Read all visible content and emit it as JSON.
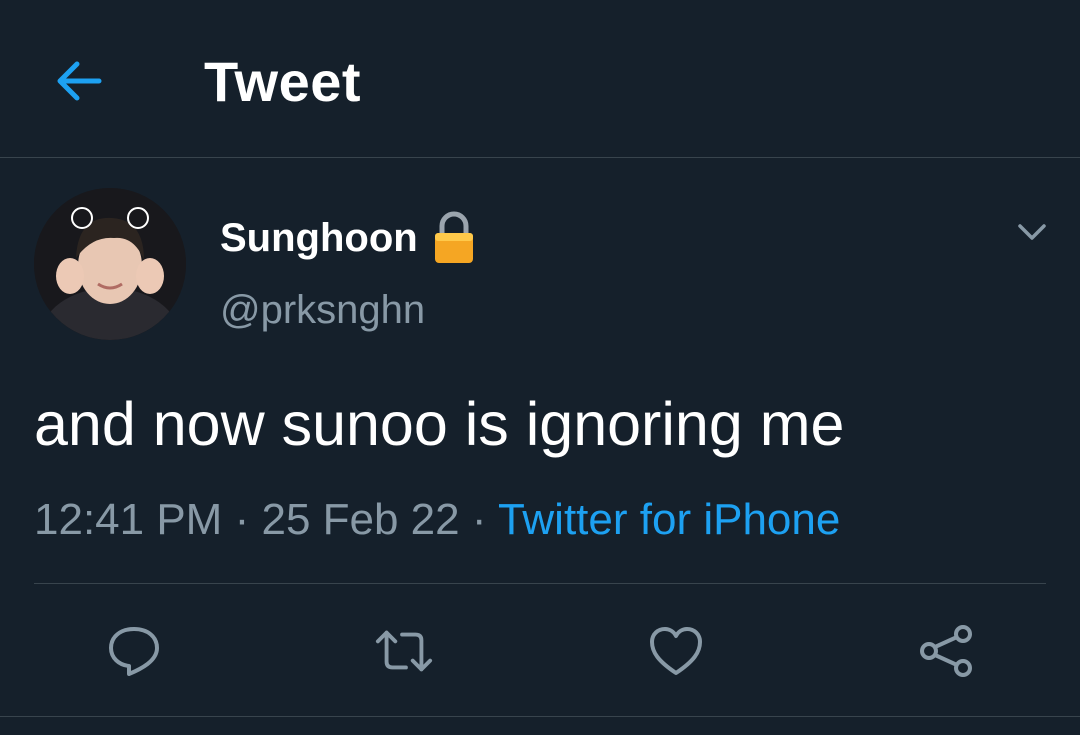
{
  "header": {
    "title": "Tweet",
    "back_icon": "arrow-left-icon",
    "accent_color": "#1da1f2"
  },
  "tweet": {
    "author": {
      "display_name": "Sunghoon",
      "handle": "@prksnghn",
      "protected_icon": "lock-icon"
    },
    "text": "and now sunoo is ignoring me",
    "time": "12:41 PM",
    "date": "25 Feb 22",
    "separator": "·",
    "source": "Twitter for iPhone",
    "more_icon": "chevron-down-icon"
  },
  "actions": [
    {
      "name": "reply",
      "icon": "reply-icon"
    },
    {
      "name": "retweet",
      "icon": "retweet-icon"
    },
    {
      "name": "like",
      "icon": "heart-icon"
    },
    {
      "name": "share",
      "icon": "share-icon"
    }
  ],
  "colors": {
    "background": "#15202b",
    "secondary_text": "#8899a6",
    "divider": "#38444d",
    "link": "#1da1f2"
  }
}
